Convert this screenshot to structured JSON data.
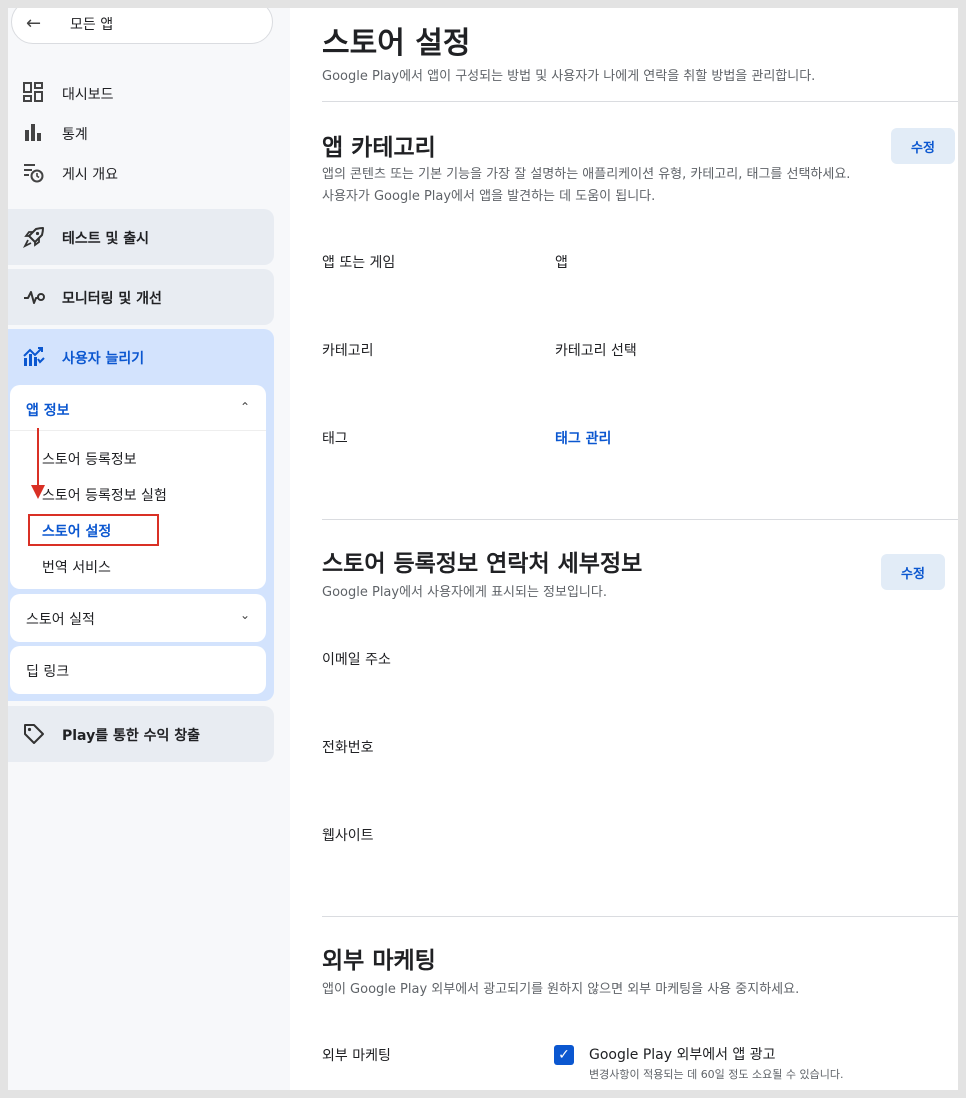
{
  "colors": {
    "accent": "#0b57d0",
    "annotation": "#d93025",
    "active_bg": "#d3e3fd"
  },
  "sidebar": {
    "all_apps": {
      "icon": "arrow-left-icon",
      "label": "모든 앱"
    },
    "items": [
      {
        "icon": "dashboard-icon",
        "label": "대시보드"
      },
      {
        "icon": "bar-chart-icon",
        "label": "통계"
      },
      {
        "icon": "publish-overview-icon",
        "label": "게시 개요"
      }
    ],
    "cards": [
      {
        "icon": "rocket-icon",
        "label": "테스트 및 출시"
      },
      {
        "icon": "monitor-icon",
        "label": "모니터링 및 개선"
      }
    ],
    "grow": {
      "icon": "grow-users-icon",
      "label": "사용자 늘리기",
      "app_info": {
        "label": "앱 정보",
        "subitems": [
          "스토어 등록정보",
          "스토어 등록정보 실험",
          "스토어 설정",
          "번역 서비스"
        ]
      },
      "store_performance": "스토어 실적",
      "deep_links": "딥 링크"
    },
    "monetize": {
      "icon": "tag-icon",
      "label": "Play를 통한 수익 창출"
    }
  },
  "main": {
    "title": "스토어 설정",
    "subtitle": "Google Play에서 앱이 구성되는 방법 및 사용자가 나에게 연락을 취할 방법을 관리합니다.",
    "category": {
      "title": "앱 카테고리",
      "desc_line1": "앱의 콘텐츠 또는 기본 기능을 가장 잘 설명하는 애플리케이션 유형, 카테고리, 태그를 선택하세요.",
      "desc_line2": "사용자가 Google Play에서 앱을 발견하는 데 도움이 됩니다.",
      "edit_label": "수정",
      "rows": [
        {
          "label": "앱 또는 게임",
          "value": "앱"
        },
        {
          "label": "카테고리",
          "value": "카테고리 선택"
        },
        {
          "label": "태그",
          "value": "태그 관리"
        }
      ]
    },
    "contact": {
      "title": "스토어 등록정보 연락처 세부정보",
      "desc": "Google Play에서 사용자에게 표시되는 정보입니다.",
      "edit_label": "수정",
      "rows": [
        "이메일 주소",
        "전화번호",
        "웹사이트"
      ]
    },
    "marketing": {
      "title": "외부 마케팅",
      "desc": "앱이 Google Play 외부에서 광고되기를 원하지 않으면 외부 마케팅을 사용 중지하세요.",
      "row_label": "외부 마케팅",
      "checkbox_label": "Google Play 외부에서 앱 광고",
      "checkbox_note": "변경사항이 적용되는 데 60일 정도 소요될 수 있습니다.",
      "checked": true
    }
  }
}
